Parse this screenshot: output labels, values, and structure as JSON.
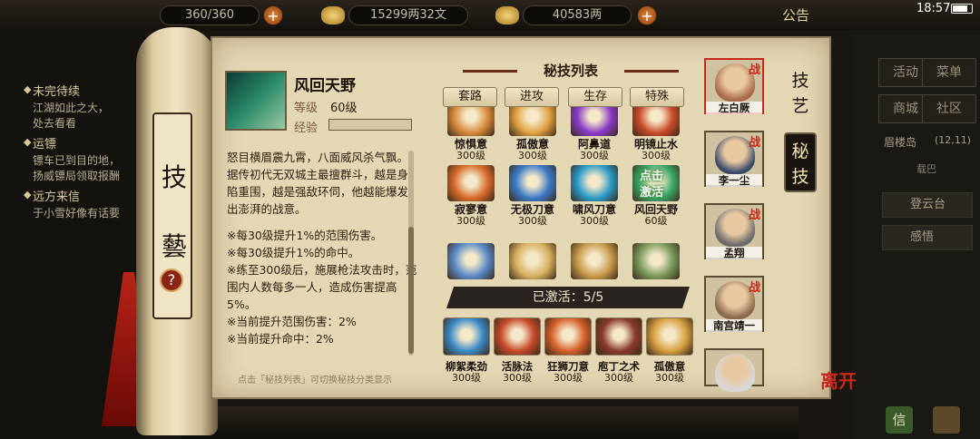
{
  "top": {
    "stamina": "360/360",
    "silver": "15299两32文",
    "gold": "40583两",
    "announce": "公告",
    "time": "18:57"
  },
  "quest": {
    "items": [
      {
        "head": "未完待续",
        "lines": [
          "江湖如此之大，",
          "处去看看"
        ]
      },
      {
        "head": "运镖",
        "lines": [
          "镖车已到目的地，",
          "扬威镖局领取报酬"
        ]
      },
      {
        "head": "远方来信",
        "lines": [
          "于小雪好像有话要"
        ]
      }
    ]
  },
  "right_menu": {
    "buttons": [
      "活动",
      "菜单",
      "商城",
      "社区"
    ],
    "location": "眉楼岛",
    "coords": "(12,11)",
    "boat": "载巴",
    "deng": "登云台",
    "gan": "感悟",
    "xin": "信"
  },
  "scroll": {
    "title_top": "技",
    "title_bottom": "藝",
    "help": "?"
  },
  "skill": {
    "name": "风回天野",
    "level_label": "等级",
    "level_value": "60级",
    "exp_label": "经验",
    "desc_main": "怒目横眉震九霄，八面威风杀气飘。据传初代无双城主最擅群斗，越是身陷重围，越是强敌环伺，他越能爆发出澎湃的战意。",
    "effects": [
      "※每30级提升1%的范围伤害。",
      "※每30级提升1%的命中。",
      "※练至300级后，施展枪法攻击时，范围内人数每多一人，造成伤害提高5%。",
      "※当前提升范围伤害：2%",
      "※当前提升命中：2%"
    ],
    "hint": "点击「秘技列表」可切换秘技分类显示"
  },
  "list": {
    "title": "秘技列表",
    "tabs": [
      "套路",
      "进攻",
      "生存",
      "特殊"
    ],
    "row1": [
      {
        "name": "惊惧意",
        "level": "300级",
        "color": "#d88a3a"
      },
      {
        "name": "孤傲意",
        "level": "300级",
        "color": "#e0a040"
      },
      {
        "name": "阿鼻道",
        "level": "300级",
        "color": "#8a3ac8"
      },
      {
        "name": "明镜止水",
        "level": "300级",
        "color": "#c84a2a"
      }
    ],
    "row2": [
      {
        "name": "寂寥意",
        "level": "300级",
        "color": "#d86a2a"
      },
      {
        "name": "无极刀意",
        "level": "300级",
        "color": "#3a7ac8"
      },
      {
        "name": "啸风刀意",
        "level": "300级",
        "color": "#2a9ac8"
      },
      {
        "name": "风回天野",
        "level": "60级",
        "color": "#3aa86a",
        "activate": "点击\n激活"
      }
    ],
    "row3": [
      {
        "color": "#5a8ac8"
      },
      {
        "color": "#d8b060"
      },
      {
        "color": "#c89a4a"
      },
      {
        "color": "#7a9a5a"
      }
    ],
    "active_label": "已激活：5/5",
    "equipped": [
      {
        "name": "柳絮柔劲",
        "level": "300级",
        "color": "#3a8ac8"
      },
      {
        "name": "活脉法",
        "level": "300级",
        "color": "#c84a2a"
      },
      {
        "name": "狂狮刀意",
        "level": "300级",
        "color": "#d8602a"
      },
      {
        "name": "庖丁之术",
        "level": "300级",
        "color": "#8a3a2a"
      },
      {
        "name": "孤傲意",
        "level": "300级",
        "color": "#d8a040"
      }
    ]
  },
  "characters": [
    {
      "name": "左白厥",
      "zhan": "战",
      "color": "#a86a4a"
    },
    {
      "name": "李一尘",
      "zhan": "战",
      "color": "#3a4a6a"
    },
    {
      "name": "孟翔",
      "zhan": "战",
      "color": "#6a6a6a"
    },
    {
      "name": "南宫靖一",
      "zhan": "战",
      "color": "#8a6a4a"
    },
    {
      "name": "",
      "zhan": "",
      "color": "#d8d8d8"
    }
  ],
  "side_tabs": {
    "first": "技艺",
    "second": "秘技"
  },
  "leave": "离开"
}
